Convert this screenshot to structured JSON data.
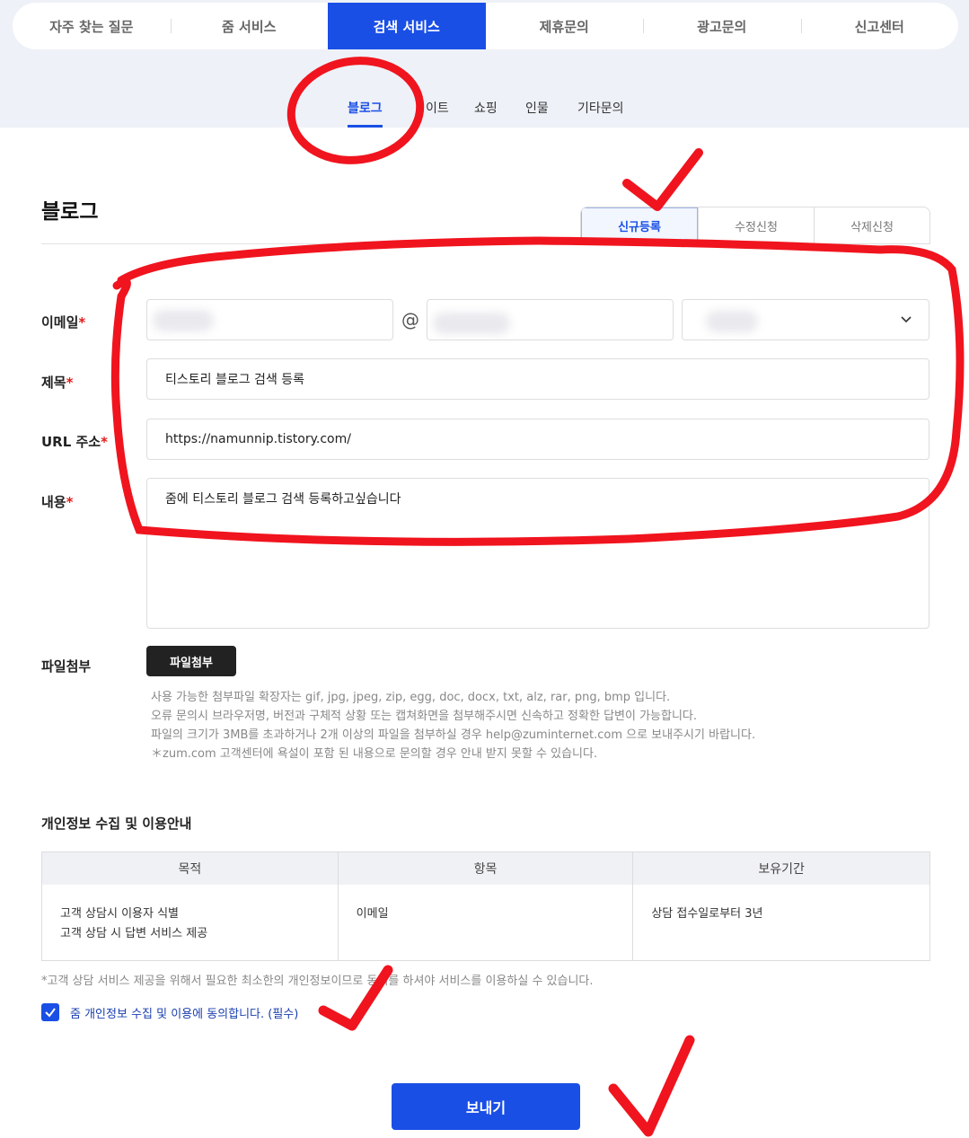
{
  "main_tabs": [
    "자주 찾는 질문",
    "줌 서비스",
    "검색 서비스",
    "제휴문의",
    "광고문의",
    "신고센터"
  ],
  "sub_tabs": [
    "블로그",
    "이트",
    "쇼핑",
    "인물",
    "기타문의"
  ],
  "page_title": "블로그",
  "request_types": [
    "신규등록",
    "수정신청",
    "삭제신청"
  ],
  "form": {
    "email_label": "이메일",
    "at_sign": "@",
    "title_label": "제목",
    "title_value": "티스토리 블로그 검색 등록",
    "url_label": "URL 주소",
    "url_value": "https://namunnip.tistory.com/",
    "content_label": "내용",
    "content_value": "줌에 티스토리 블로그 검색 등록하고싶습니다",
    "required_mark": "*"
  },
  "attachment": {
    "label": "파일첨부",
    "button": "파일첨부",
    "notes": [
      "사용 가능한 첨부파일 확장자는 gif, jpg, jpeg, zip, egg, doc, docx, txt, alz, rar, png, bmp 입니다.",
      "오류 문의시 브라우저명, 버전과 구체적 상황 또는 캡쳐화면을 첨부해주시면 신속하고 정확한 답변이 가능합니다.",
      "파일의 크기가 3MB를 초과하거나 2개 이상의 파일을 첨부하실 경우 help@zuminternet.com 으로 보내주시기 바랍니다.",
      "＊zum.com 고객센터에 욕설이 포함 된 내용으로 문의할 경우 안내 받지 못할 수 있습니다."
    ]
  },
  "privacy": {
    "title": "개인정보 수집 및 이용안내",
    "headers": [
      "목적",
      "항목",
      "보유기간"
    ],
    "purpose": [
      "고객 상담시 이용자 식별",
      "고객 상담 시 답변 서비스 제공"
    ],
    "item": "이메일",
    "period": "상담 접수일로부터 3년",
    "note": "*고객 상담 서비스 제공을 위해서 필요한 최소한의 개인정보이므로 동의를 하셔야 서비스를 이용하실 수 있습니다.",
    "agree_text": "줌 개인정보 수집 및 이용에 동의합니다. (필수)",
    "agree_checked": true
  },
  "submit_label": "보내기",
  "colors": {
    "accent": "#1a4fe6",
    "required": "#e21b1b",
    "annotation": "#f0141e"
  }
}
